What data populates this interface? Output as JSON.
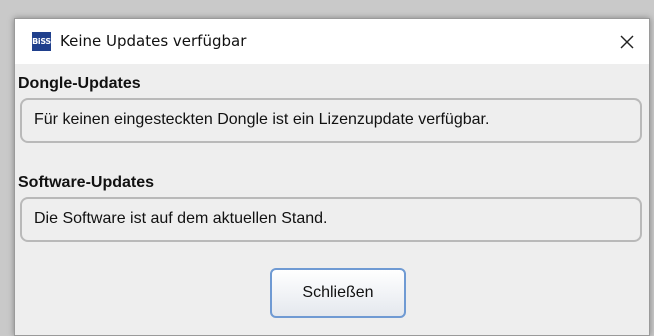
{
  "window": {
    "title": "Keine Updates verfügbar",
    "app_icon_text": "BiSS"
  },
  "dongle_section": {
    "heading": "Dongle-Updates",
    "message": "Für keinen eingesteckten Dongle ist ein Lizenzupdate verfügbar."
  },
  "software_section": {
    "heading": "Software-Updates",
    "message": "Die Software ist auf dem aktuellen Stand."
  },
  "buttons": {
    "close_label": "Schließen"
  },
  "icons": {
    "app": "biss-app-icon",
    "close": "close-icon"
  },
  "colors": {
    "accent_border": "#6f9ad3",
    "dialog_bg": "#eeeeee",
    "app_icon_bg": "#1f3f8c"
  }
}
